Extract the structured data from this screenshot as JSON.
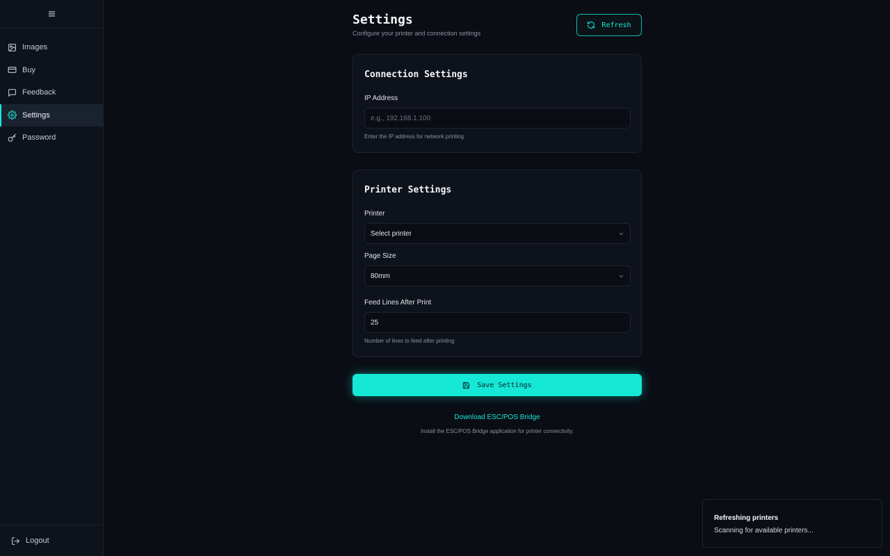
{
  "sidebar": {
    "toggle_icon": "hamburger-icon",
    "items": [
      {
        "label": "Images",
        "icon": "image-icon",
        "active": false
      },
      {
        "label": "Buy",
        "icon": "credit-card-icon",
        "active": false
      },
      {
        "label": "Feedback",
        "icon": "message-square-icon",
        "active": false
      },
      {
        "label": "Settings",
        "icon": "gear-icon",
        "active": true
      },
      {
        "label": "Password",
        "icon": "key-icon",
        "active": false
      }
    ],
    "logout_label": "Logout"
  },
  "header": {
    "title": "Settings",
    "subtitle": "Configure your printer and connection settings",
    "refresh_label": "Refresh"
  },
  "connection": {
    "title": "Connection Settings",
    "ip_label": "IP Address",
    "ip_value": "",
    "ip_placeholder": "e.g., 192.168.1.100",
    "ip_helper": "Enter the IP address for network printing"
  },
  "printer": {
    "title": "Printer Settings",
    "printer_label": "Printer",
    "printer_value": "Select printer",
    "page_size_label": "Page Size",
    "page_size_value": "80mm",
    "feed_label": "Feed Lines After Print",
    "feed_value": "25",
    "feed_helper": "Number of lines to feed after printing"
  },
  "actions": {
    "save_label": "Save Settings",
    "download_label": "Download ESC/POS Bridge",
    "download_desc": "Install the ESC/POS Bridge application for printer connectivity."
  },
  "toast": {
    "title": "Refreshing printers",
    "description": "Scanning for available printers..."
  },
  "colors": {
    "accent": "#15e8d6",
    "background": "#0a0d14",
    "sidebar": "#0e121b"
  }
}
